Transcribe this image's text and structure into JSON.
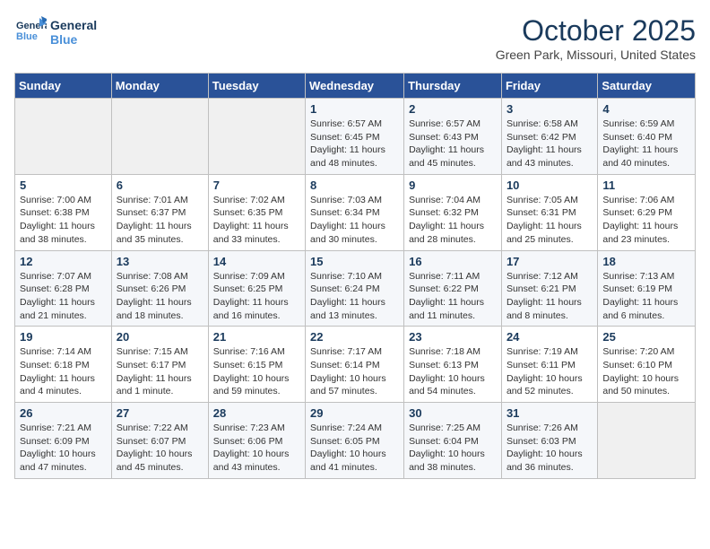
{
  "header": {
    "logo_line1": "General",
    "logo_line2": "Blue",
    "month": "October 2025",
    "location": "Green Park, Missouri, United States"
  },
  "weekdays": [
    "Sunday",
    "Monday",
    "Tuesday",
    "Wednesday",
    "Thursday",
    "Friday",
    "Saturday"
  ],
  "weeks": [
    [
      {
        "day": "",
        "info": ""
      },
      {
        "day": "",
        "info": ""
      },
      {
        "day": "",
        "info": ""
      },
      {
        "day": "1",
        "info": "Sunrise: 6:57 AM\nSunset: 6:45 PM\nDaylight: 11 hours\nand 48 minutes."
      },
      {
        "day": "2",
        "info": "Sunrise: 6:57 AM\nSunset: 6:43 PM\nDaylight: 11 hours\nand 45 minutes."
      },
      {
        "day": "3",
        "info": "Sunrise: 6:58 AM\nSunset: 6:42 PM\nDaylight: 11 hours\nand 43 minutes."
      },
      {
        "day": "4",
        "info": "Sunrise: 6:59 AM\nSunset: 6:40 PM\nDaylight: 11 hours\nand 40 minutes."
      }
    ],
    [
      {
        "day": "5",
        "info": "Sunrise: 7:00 AM\nSunset: 6:38 PM\nDaylight: 11 hours\nand 38 minutes."
      },
      {
        "day": "6",
        "info": "Sunrise: 7:01 AM\nSunset: 6:37 PM\nDaylight: 11 hours\nand 35 minutes."
      },
      {
        "day": "7",
        "info": "Sunrise: 7:02 AM\nSunset: 6:35 PM\nDaylight: 11 hours\nand 33 minutes."
      },
      {
        "day": "8",
        "info": "Sunrise: 7:03 AM\nSunset: 6:34 PM\nDaylight: 11 hours\nand 30 minutes."
      },
      {
        "day": "9",
        "info": "Sunrise: 7:04 AM\nSunset: 6:32 PM\nDaylight: 11 hours\nand 28 minutes."
      },
      {
        "day": "10",
        "info": "Sunrise: 7:05 AM\nSunset: 6:31 PM\nDaylight: 11 hours\nand 25 minutes."
      },
      {
        "day": "11",
        "info": "Sunrise: 7:06 AM\nSunset: 6:29 PM\nDaylight: 11 hours\nand 23 minutes."
      }
    ],
    [
      {
        "day": "12",
        "info": "Sunrise: 7:07 AM\nSunset: 6:28 PM\nDaylight: 11 hours\nand 21 minutes."
      },
      {
        "day": "13",
        "info": "Sunrise: 7:08 AM\nSunset: 6:26 PM\nDaylight: 11 hours\nand 18 minutes."
      },
      {
        "day": "14",
        "info": "Sunrise: 7:09 AM\nSunset: 6:25 PM\nDaylight: 11 hours\nand 16 minutes."
      },
      {
        "day": "15",
        "info": "Sunrise: 7:10 AM\nSunset: 6:24 PM\nDaylight: 11 hours\nand 13 minutes."
      },
      {
        "day": "16",
        "info": "Sunrise: 7:11 AM\nSunset: 6:22 PM\nDaylight: 11 hours\nand 11 minutes."
      },
      {
        "day": "17",
        "info": "Sunrise: 7:12 AM\nSunset: 6:21 PM\nDaylight: 11 hours\nand 8 minutes."
      },
      {
        "day": "18",
        "info": "Sunrise: 7:13 AM\nSunset: 6:19 PM\nDaylight: 11 hours\nand 6 minutes."
      }
    ],
    [
      {
        "day": "19",
        "info": "Sunrise: 7:14 AM\nSunset: 6:18 PM\nDaylight: 11 hours\nand 4 minutes."
      },
      {
        "day": "20",
        "info": "Sunrise: 7:15 AM\nSunset: 6:17 PM\nDaylight: 11 hours\nand 1 minute."
      },
      {
        "day": "21",
        "info": "Sunrise: 7:16 AM\nSunset: 6:15 PM\nDaylight: 10 hours\nand 59 minutes."
      },
      {
        "day": "22",
        "info": "Sunrise: 7:17 AM\nSunset: 6:14 PM\nDaylight: 10 hours\nand 57 minutes."
      },
      {
        "day": "23",
        "info": "Sunrise: 7:18 AM\nSunset: 6:13 PM\nDaylight: 10 hours\nand 54 minutes."
      },
      {
        "day": "24",
        "info": "Sunrise: 7:19 AM\nSunset: 6:11 PM\nDaylight: 10 hours\nand 52 minutes."
      },
      {
        "day": "25",
        "info": "Sunrise: 7:20 AM\nSunset: 6:10 PM\nDaylight: 10 hours\nand 50 minutes."
      }
    ],
    [
      {
        "day": "26",
        "info": "Sunrise: 7:21 AM\nSunset: 6:09 PM\nDaylight: 10 hours\nand 47 minutes."
      },
      {
        "day": "27",
        "info": "Sunrise: 7:22 AM\nSunset: 6:07 PM\nDaylight: 10 hours\nand 45 minutes."
      },
      {
        "day": "28",
        "info": "Sunrise: 7:23 AM\nSunset: 6:06 PM\nDaylight: 10 hours\nand 43 minutes."
      },
      {
        "day": "29",
        "info": "Sunrise: 7:24 AM\nSunset: 6:05 PM\nDaylight: 10 hours\nand 41 minutes."
      },
      {
        "day": "30",
        "info": "Sunrise: 7:25 AM\nSunset: 6:04 PM\nDaylight: 10 hours\nand 38 minutes."
      },
      {
        "day": "31",
        "info": "Sunrise: 7:26 AM\nSunset: 6:03 PM\nDaylight: 10 hours\nand 36 minutes."
      },
      {
        "day": "",
        "info": ""
      }
    ]
  ]
}
